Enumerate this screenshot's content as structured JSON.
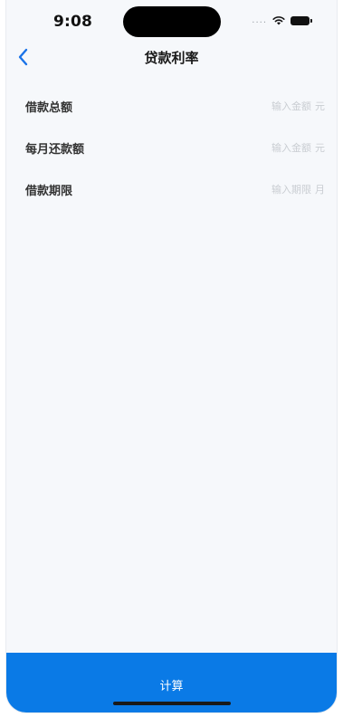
{
  "status_bar": {
    "time": "9:08",
    "signal_icon": "signal-dots-icon",
    "wifi_icon": "wifi-icon",
    "battery_icon": "battery-icon"
  },
  "nav": {
    "back_icon": "chevron-left-icon",
    "title": "贷款利率",
    "accent_color": "#1a73e8"
  },
  "form": {
    "rows": [
      {
        "label": "借款总额",
        "placeholder": "输入金额",
        "value": "",
        "unit": "元"
      },
      {
        "label": "每月还款额",
        "placeholder": "输入金额",
        "value": "",
        "unit": "元"
      },
      {
        "label": "借款期限",
        "placeholder": "输入期限",
        "value": "",
        "unit": "月"
      }
    ]
  },
  "footer": {
    "calculate_label": "计算",
    "button_color": "#0a7ae6"
  }
}
